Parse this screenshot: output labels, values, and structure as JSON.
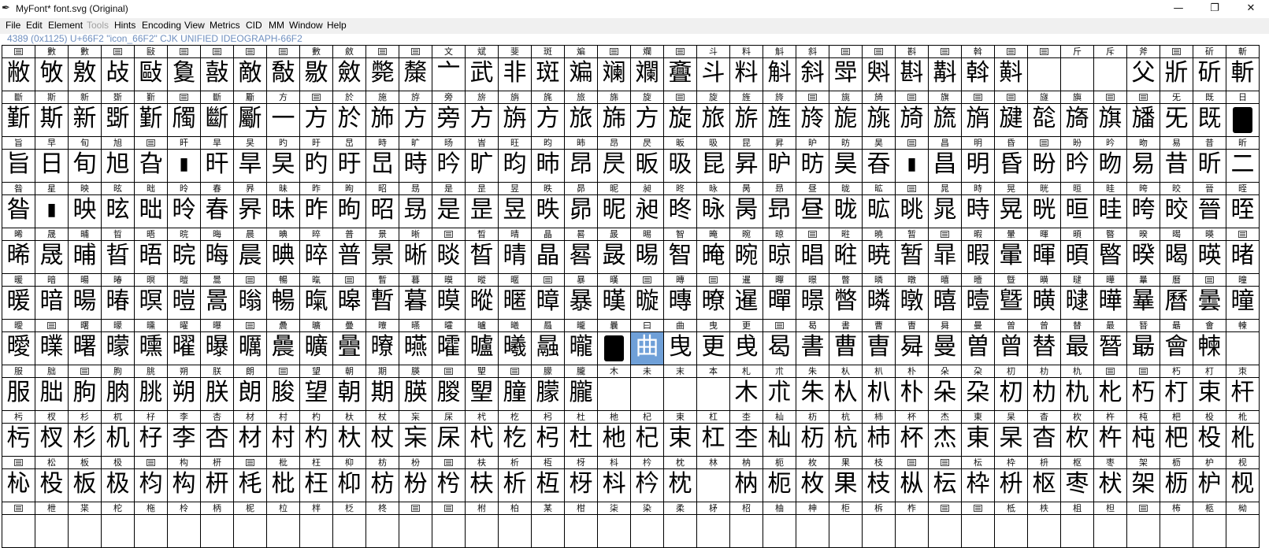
{
  "window": {
    "title": "MyFont* font.svg (Original)",
    "app_icon": "pen-nib-icon",
    "minimize_label": "—",
    "restore_label": "❐",
    "close_label": "✕"
  },
  "menu": {
    "items": [
      {
        "label": "File",
        "enabled": true
      },
      {
        "label": "Edit",
        "enabled": true
      },
      {
        "label": "Element",
        "enabled": true
      },
      {
        "label": "Tools",
        "enabled": false
      },
      {
        "label": "Hints",
        "enabled": true
      },
      {
        "label": "Encoding",
        "enabled": true
      },
      {
        "label": "View",
        "enabled": true
      },
      {
        "label": "Metrics",
        "enabled": true
      },
      {
        "label": "CID",
        "enabled": true
      },
      {
        "label": "MM",
        "enabled": true
      },
      {
        "label": "Window",
        "enabled": true
      },
      {
        "label": "Help",
        "enabled": true
      }
    ]
  },
  "info": {
    "text": "4389 (0x1125) U+66F2 \"icon_66F2\" CJK UNIFIED IDEOGRAPH-66F2"
  },
  "selected": {
    "row": 6,
    "col": 19
  },
  "rows": [
    {
      "labels": [
        "?",
        "數",
        "數",
        "?",
        "敺",
        "?",
        "?",
        "?",
        "?",
        "數",
        "斂",
        "?",
        "?",
        "文",
        "斌",
        "斐",
        "斑",
        "斒",
        "?",
        "斕",
        "?",
        "斗",
        "料",
        "斛",
        "斜",
        "?",
        "?",
        "斟",
        "?",
        "斡",
        "?",
        "?",
        "斤",
        "斥",
        "斧",
        "?",
        "斫",
        "斬"
      ],
      "glyphs": [
        "敝",
        "敂",
        "敫",
        "敁",
        "敺",
        "敻",
        "敼",
        "敵",
        "敽",
        "敭",
        "斂",
        "斃",
        "斄",
        "亠",
        "武",
        "非",
        "斑",
        "斒",
        "斓",
        "斕",
        "斖",
        "斗",
        "料",
        "斛",
        "斜",
        "斝",
        "斞",
        "斟",
        "斠",
        "斡",
        "斢",
        "",
        "",
        "",
        "父",
        "斨",
        "斫",
        "斬"
      ]
    },
    {
      "labels": [
        "斷",
        "斯",
        "新",
        "斲",
        "斳",
        "?",
        "斷",
        "斸",
        "方",
        "?",
        "於",
        "施",
        "斿",
        "旁",
        "旂",
        "旃",
        "旄",
        "旅",
        "旆",
        "旋",
        "?",
        "旋",
        "旌",
        "旍",
        "?",
        "旐",
        "旑",
        "?",
        "旗",
        "?",
        "?",
        "旞",
        "旟",
        "?",
        "?",
        "旡",
        "既",
        "日"
      ],
      "glyphs": [
        "斳",
        "斯",
        "新",
        "斲",
        "斳",
        "斶",
        "斷",
        "斸",
        "一",
        "方",
        "於",
        "斾",
        "方",
        "旁",
        "方",
        "旃",
        "方",
        "旅",
        "旆",
        "方",
        "旋",
        "旅",
        "旂",
        "旌",
        "旍",
        "旎",
        "旐",
        "旑",
        "旒",
        "旓",
        "旔",
        "旕",
        "旖",
        "旗",
        "旙",
        "旡",
        "既",
        "■"
      ]
    },
    {
      "labels": [
        "旨",
        "早",
        "旬",
        "旭",
        "?",
        "旰",
        "旱",
        "旲",
        "旳",
        "旴",
        "旵",
        "時",
        "旷",
        "旸",
        "旹",
        "旺",
        "昀",
        "昁",
        "昂",
        "昃",
        "昄",
        "昅",
        "昆",
        "昇",
        "昈",
        "昉",
        "昊",
        "?",
        "昌",
        "明",
        "昏",
        "?",
        "昐",
        "昑",
        "昒",
        "易",
        "昔",
        "昕"
      ],
      "glyphs": [
        "旨",
        "日",
        "旬",
        "旭",
        "旮",
        "▮",
        "旰",
        "旱",
        "旲",
        "旳",
        "旴",
        "旵",
        "時",
        "昑",
        "旷",
        "昀",
        "昁",
        "昂",
        "昃",
        "昄",
        "昅",
        "昆",
        "昇",
        "昈",
        "昉",
        "昊",
        "昋",
        "▮",
        "昌",
        "明",
        "昏",
        "昐",
        "昑",
        "昒",
        "易",
        "昔",
        "昕",
        "二"
      ]
    },
    {
      "labels": [
        "昝",
        "星",
        "映",
        "昡",
        "昢",
        "昤",
        "春",
        "昦",
        "昧",
        "昨",
        "昫",
        "昭",
        "昮",
        "是",
        "昰",
        "昱",
        "昳",
        "昴",
        "昵",
        "昶",
        "昸",
        "昹",
        "昺",
        "昻",
        "昼",
        "昽",
        "昿",
        "?",
        "晁",
        "時",
        "晃",
        "晄",
        "晅",
        "晆",
        "晇",
        "晈",
        "晉",
        "晊"
      ],
      "glyphs": [
        "昝",
        "▮",
        "映",
        "昡",
        "昢",
        "昤",
        "春",
        "昦",
        "昧",
        "昨",
        "昫",
        "昭",
        "昮",
        "是",
        "昰",
        "昱",
        "昳",
        "昴",
        "昵",
        "昶",
        "昸",
        "昹",
        "昺",
        "昻",
        "昼",
        "昽",
        "昿",
        "晀",
        "晁",
        "時",
        "晃",
        "晄",
        "晅",
        "晆",
        "晇",
        "晈",
        "晉",
        "晊"
      ]
    },
    {
      "labels": [
        "晞",
        "晟",
        "晡",
        "晢",
        "晤",
        "晥",
        "晦",
        "晨",
        "晪",
        "晬",
        "普",
        "景",
        "晰",
        "?",
        "晳",
        "晴",
        "晶",
        "晷",
        "晸",
        "晹",
        "智",
        "晻",
        "晼",
        "晾",
        "?",
        "暀",
        "暁",
        "暂",
        "?",
        "暇",
        "暈",
        "暉",
        "暊",
        "暋",
        "暌",
        "暍",
        "暎",
        "?"
      ],
      "glyphs": [
        "晞",
        "晟",
        "晡",
        "晢",
        "晤",
        "晥",
        "晦",
        "晨",
        "晪",
        "晬",
        "普",
        "景",
        "晰",
        "晱",
        "晳",
        "晴",
        "晶",
        "晷",
        "晸",
        "晹",
        "智",
        "晻",
        "晼",
        "晾",
        "晿",
        "暀",
        "暁",
        "暂",
        "暃",
        "暇",
        "暈",
        "暉",
        "暊",
        "暋",
        "暌",
        "暍",
        "暎",
        "暏"
      ]
    },
    {
      "labels": [
        "暖",
        "暗",
        "暘",
        "暙",
        "暝",
        "暟",
        "暠",
        "?",
        "暢",
        "暣",
        "?",
        "暫",
        "暮",
        "暯",
        "暰",
        "暱",
        "?",
        "暴",
        "暵",
        "?",
        "暷",
        "?",
        "暹",
        "暺",
        "暻",
        "暼",
        "暽",
        "暾",
        "暿",
        "曀",
        "曁",
        "曂",
        "曃",
        "曄",
        "曅",
        "曆",
        "?",
        "曈"
      ],
      "glyphs": [
        "暖",
        "暗",
        "暘",
        "暙",
        "暝",
        "暟",
        "暠",
        "暡",
        "暢",
        "暣",
        "暤",
        "暫",
        "暮",
        "暯",
        "暰",
        "暱",
        "暲",
        "暴",
        "暵",
        "暶",
        "暷",
        "暸",
        "暹",
        "暺",
        "暻",
        "暼",
        "暽",
        "暾",
        "暿",
        "曀",
        "曁",
        "曂",
        "曃",
        "曄",
        "曅",
        "曆",
        "曇",
        "曈"
      ]
    },
    {
      "labels": [
        "曖",
        "?",
        "曙",
        "曚",
        "曛",
        "曜",
        "曝",
        "?",
        "曟",
        "曠",
        "曡",
        "曢",
        "曣",
        "曤",
        "曥",
        "曦",
        "曧",
        "曨",
        "曩",
        "曰",
        "曲",
        "曳",
        "更",
        "?",
        "曷",
        "書",
        "曹",
        "曺",
        "曻",
        "曼",
        "曽",
        "曾",
        "替",
        "最",
        "朁",
        "朂",
        "會",
        "朄"
      ],
      "glyphs": [
        "曖",
        "曗",
        "曙",
        "曚",
        "曛",
        "曜",
        "曝",
        "曞",
        "曟",
        "曠",
        "曡",
        "曢",
        "曣",
        "曤",
        "曥",
        "曦",
        "曧",
        "曨",
        "■",
        "曲",
        "曳",
        "更",
        "曵",
        "曷",
        "書",
        "曹",
        "曺",
        "曻",
        "曼",
        "曽",
        "曾",
        "替",
        "最",
        "朁",
        "朂",
        "會",
        "朄",
        ""
      ]
    },
    {
      "labels": [
        "服",
        "朏",
        "?",
        "朐",
        "朓",
        "朔",
        "朕",
        "朗",
        "?",
        "望",
        "朝",
        "期",
        "朠",
        "?",
        "朢",
        "?",
        "朦",
        "朧",
        "木",
        "未",
        "末",
        "本",
        "札",
        "朮",
        "朱",
        "朲",
        "朳",
        "朴",
        "朵",
        "朶",
        "朷",
        "朸",
        "朹",
        "?",
        "?",
        "朽",
        "朾",
        "朿"
      ],
      "glyphs": [
        "服",
        "朏",
        "朐",
        "朒",
        "朓",
        "朔",
        "朕",
        "朗",
        "朘",
        "望",
        "朝",
        "期",
        "朠",
        "朡",
        "朢",
        "朣",
        "朦",
        "朧",
        "",
        "",
        "",
        "",
        "木",
        "朮",
        "朱",
        "朲",
        "朳",
        "朴",
        "朵",
        "朶",
        "朷",
        "朸",
        "朹",
        "朼",
        "朽",
        "朾",
        "束",
        "杆"
      ]
    },
    {
      "labels": [
        "杇",
        "杈",
        "杉",
        "杌",
        "杍",
        "李",
        "杏",
        "材",
        "村",
        "杓",
        "杕",
        "杖",
        "杗",
        "杘",
        "杙",
        "杚",
        "杛",
        "杜",
        "杝",
        "杞",
        "束",
        "杠",
        "杢",
        "杣",
        "杤",
        "杭",
        "杮",
        "杯",
        "杰",
        "東",
        "杲",
        "杳",
        "杴",
        "杵",
        "杶",
        "杷",
        "杸",
        "杹"
      ],
      "glyphs": [
        "杇",
        "杈",
        "杉",
        "机",
        "杍",
        "李",
        "杏",
        "材",
        "村",
        "杓",
        "杕",
        "杖",
        "杗",
        "杘",
        "杙",
        "杚",
        "杛",
        "杜",
        "杝",
        "杞",
        "束",
        "杠",
        "杢",
        "杣",
        "杤",
        "杭",
        "杮",
        "杯",
        "杰",
        "東",
        "杲",
        "杳",
        "杴",
        "杵",
        "杶",
        "杷",
        "杸",
        "杹"
      ]
    },
    {
      "labels": [
        "?",
        "松",
        "板",
        "极",
        "?",
        "构",
        "枅",
        "?",
        "枇",
        "枉",
        "枊",
        "枋",
        "枌",
        "?",
        "枎",
        "析",
        "枑",
        "枒",
        "枓",
        "枔",
        "枕",
        "林",
        "枘",
        "枙",
        "枚",
        "果",
        "枝",
        "?",
        "?",
        "枟",
        "枠",
        "枡",
        "枢",
        "枣",
        "架",
        "枥",
        "枦",
        "枧"
      ],
      "glyphs": [
        "杺",
        "杸",
        "板",
        "极",
        "枃",
        "构",
        "枅",
        "枆",
        "枇",
        "枉",
        "枊",
        "枋",
        "枌",
        "枍",
        "枎",
        "析",
        "枑",
        "枒",
        "枓",
        "枔",
        "枕",
        "",
        "枘",
        "枙",
        "枚",
        "果",
        "枝",
        "枞",
        "枟",
        "枠",
        "枡",
        "枢",
        "枣",
        "枤",
        "架",
        "枥",
        "枦",
        "枧"
      ]
    },
    {
      "labels": [
        "?",
        "枻",
        "枼",
        "柁",
        "柂",
        "柃",
        "柄",
        "柅",
        "柆",
        "柈",
        "柉",
        "柊",
        "?",
        "?",
        "柎",
        "柏",
        "某",
        "柑",
        "柒",
        "染",
        "柔",
        "柕",
        "柖",
        "柚",
        "柛",
        "柜",
        "柝",
        "柞",
        "?",
        "?",
        "柢",
        "柣",
        "柤",
        "柦",
        "?",
        "柨",
        "柩",
        "柪"
      ],
      "glyphs": [
        "",
        "",
        "",
        "",
        "",
        "",
        "",
        "",
        "",
        "",
        "",
        "",
        "",
        "",
        "",
        "",
        "",
        "",
        "",
        "",
        "",
        "",
        "",
        "",
        "",
        "",
        "",
        "",
        "",
        "",
        "",
        "",
        "",
        "",
        "",
        "",
        "",
        ""
      ]
    }
  ]
}
